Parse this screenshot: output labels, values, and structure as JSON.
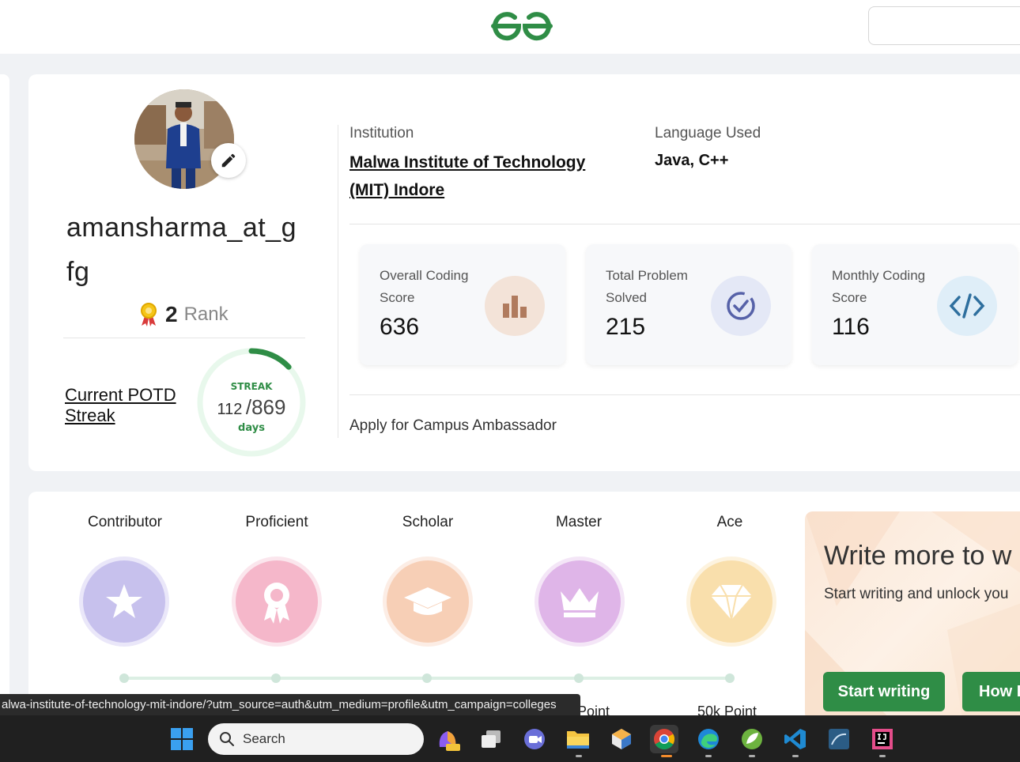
{
  "header": {
    "logo": "gfg-logo"
  },
  "profile": {
    "username": "amansharma_at_gfg",
    "rank_number": "2",
    "rank_word": "Rank",
    "potd_label": "Current POTD Streak",
    "streak": {
      "label": "STREAK",
      "current": "112",
      "total": "/869",
      "unit": "days",
      "progress": 0.129
    }
  },
  "institution": {
    "label": "Institution",
    "name": "Malwa Institute of Technology (MIT) Indore"
  },
  "language": {
    "label": "Language Used",
    "value": "Java, C++"
  },
  "stats": [
    {
      "label": "Overall Coding Score",
      "value": "636",
      "icon": "bar-chart-icon",
      "color": "#b07b5e"
    },
    {
      "label": "Total Problem Solved",
      "value": "215",
      "icon": "check-circle-icon",
      "color": "#5661a8"
    },
    {
      "label": "Monthly Coding Score",
      "value": "116",
      "icon": "code-icon",
      "color": "#2e6f9e"
    }
  ],
  "campus_link": "Apply for Campus Ambassador",
  "badges": [
    {
      "name": "Contributor",
      "icon": "star-icon",
      "color": "#9b8fe0"
    },
    {
      "name": "Proficient",
      "icon": "ribbon-icon",
      "color": "#ee7ea0"
    },
    {
      "name": "Scholar",
      "icon": "graduation-cap-icon",
      "color": "#f2a87c"
    },
    {
      "name": "Master",
      "icon": "crown-icon",
      "color": "#c57ad6"
    },
    {
      "name": "Ace",
      "icon": "diamond-icon",
      "color": "#f5c56a"
    }
  ],
  "points": {
    "p4": "Point",
    "p5": "50k Point"
  },
  "promo": {
    "title": "Write more to w",
    "subtitle": "Start writing and unlock you",
    "start_btn": "Start writing",
    "how_btn": "How E"
  },
  "status_url": "alwa-institute-of-technology-mit-indore/?utm_source=auth&utm_medium=profile&utm_campaign=colleges",
  "taskbar": {
    "search_placeholder": "Search"
  },
  "colors": {
    "brand": "#2f8d46",
    "streak_track": "#e8f8ec"
  }
}
